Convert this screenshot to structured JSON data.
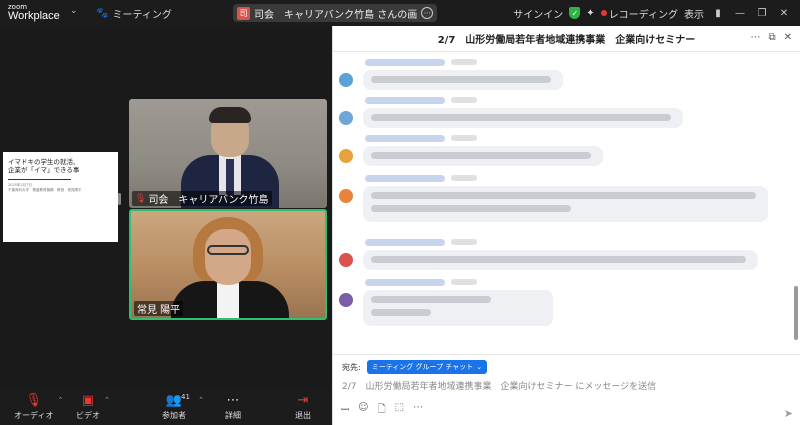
{
  "titlebar": {
    "logo_top": "zoom",
    "logo_bottom": "Workplace",
    "meeting_label": "ミーティング",
    "speaker_badge": "司",
    "speaker_text": "司会　キャリアバンク竹島 さんの画",
    "signin": "サインイン",
    "recording": "レコーディング",
    "view": "表示"
  },
  "shared_slide": {
    "title_line1": "イマドキの学生の就活、",
    "title_line2": "企業が「イマ」できる事",
    "date": "2025年2月7日",
    "presenter": "千葉商科大学　基盤教育機構　教授　常見陽平"
  },
  "participants": [
    {
      "name": "司会　キャリアバンク竹島",
      "muted": true
    },
    {
      "name": "常見 陽平",
      "muted": false
    }
  ],
  "toolbar": {
    "audio": "オーディオ",
    "video": "ビデオ",
    "participants": "参加者",
    "participant_count": "41",
    "details": "詳細",
    "leave": "退出"
  },
  "chat": {
    "title": "2/7　山形労働局若年者地域連携事業　企業向けセミナー",
    "to_label": "宛先:",
    "to_target": "ミーティング グループ チャット",
    "placeholder": "2/7　山形労働局若年者地域連携事業　企業向けセミナー にメッセージを送信",
    "avatar_colors": [
      "#5aa1d8",
      "#6fa6d6",
      "#e9a13b",
      "#e8833a",
      "#d9534f",
      "#7b5ea7",
      "#4a4f5e"
    ]
  }
}
